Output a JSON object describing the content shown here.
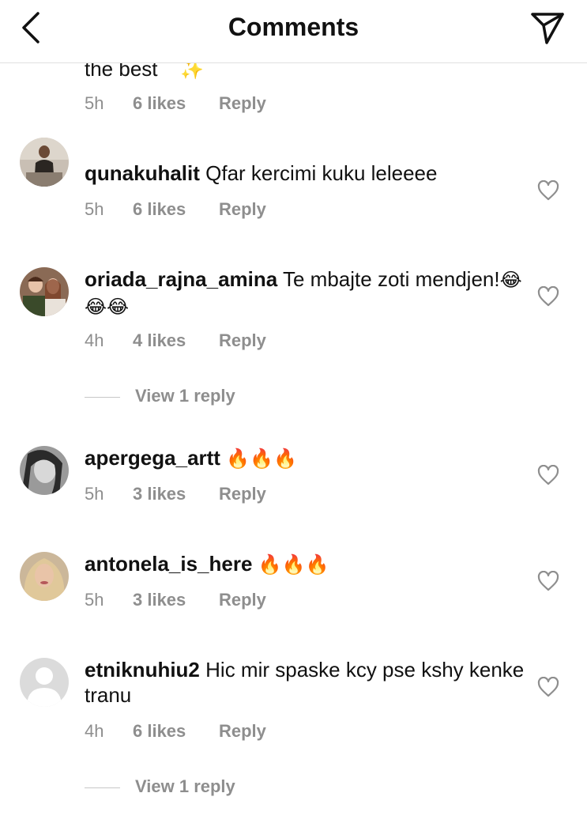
{
  "header": {
    "title": "Comments",
    "back_icon": "chevron-left-icon",
    "send_icon": "paper-plane-icon"
  },
  "top_comment": {
    "text": "the best",
    "emoji": "✨",
    "time": "5h",
    "likes": "6 likes",
    "reply": "Reply"
  },
  "comments": [
    {
      "username": "qunakuhalit",
      "text": "Qfar kercimi kuku leleeee",
      "emoji": "",
      "time": "5h",
      "likes": "6 likes",
      "reply": "Reply"
    },
    {
      "username": "oriada_rajna_amina",
      "text": "Te mbajte zoti mendjen!",
      "emoji": "😂😂😂",
      "time": "4h",
      "likes": "4 likes",
      "reply": "Reply",
      "view_replies": "View 1 reply"
    },
    {
      "username": "apergega_artt",
      "text": "",
      "emoji": "🔥🔥🔥",
      "time": "5h",
      "likes": "3 likes",
      "reply": "Reply"
    },
    {
      "username": "antonela_is_here",
      "text": "",
      "emoji": "🔥🔥🔥",
      "time": "5h",
      "likes": "3 likes",
      "reply": "Reply"
    },
    {
      "username": "etniknuhiu2",
      "text": "Hic mir spaske kcy pse kshy kenke tranu",
      "emoji": "",
      "time": "4h",
      "likes": "6 likes",
      "reply": "Reply",
      "view_replies": "View 1 reply"
    }
  ],
  "colors": {
    "text": "#111111",
    "meta": "#8e8e8e",
    "divider": "#e0e0e0"
  }
}
